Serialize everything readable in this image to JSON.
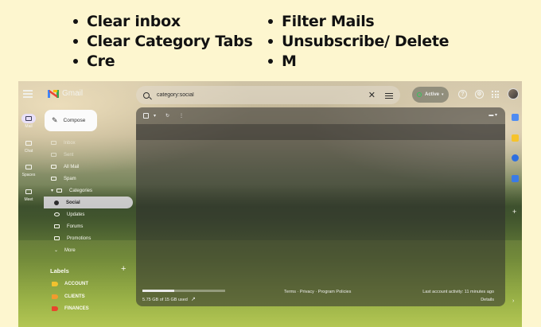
{
  "bullets": {
    "left": [
      "Clear inbox",
      "Clear Category Tabs",
      "Cre"
    ],
    "right": [
      "Filter Mails",
      "Unsubscribe/ Delete",
      "M"
    ]
  },
  "gmail": {
    "app_name": "Gmail",
    "rail": [
      {
        "label": "Mail",
        "icon": "mail-icon",
        "active": true
      },
      {
        "label": "Chat",
        "icon": "chat-icon",
        "active": false
      },
      {
        "label": "Spaces",
        "icon": "spaces-icon",
        "active": false
      },
      {
        "label": "Meet",
        "icon": "meet-icon",
        "active": false
      }
    ],
    "search": {
      "query": "category:social"
    },
    "status": {
      "label": "Active"
    },
    "compose_label": "Compose",
    "nav": [
      {
        "label": "Inbox",
        "dim": true
      },
      {
        "label": "Sent",
        "dim": true
      },
      {
        "label": "All Mail"
      },
      {
        "label": "Spam"
      },
      {
        "label": "Categories"
      },
      {
        "label": "Social",
        "active": true
      },
      {
        "label": "Updates"
      },
      {
        "label": "Forums"
      },
      {
        "label": "Promotions"
      },
      {
        "label": "More"
      }
    ],
    "labels_heading": "Labels",
    "labels": [
      {
        "name": "ACCOUNT",
        "color": "#f2c12e"
      },
      {
        "name": "CLIENTS",
        "color": "#f29b2e"
      },
      {
        "name": "FINANCES",
        "color": "#e8452c"
      }
    ],
    "footer": {
      "storage": "5.75 GB of 15 GB used",
      "storage_fraction": 0.38,
      "links": "Terms · Privacy · Program Policies",
      "activity": "Last account activity: 11 minutes ago",
      "details": "Details"
    }
  }
}
